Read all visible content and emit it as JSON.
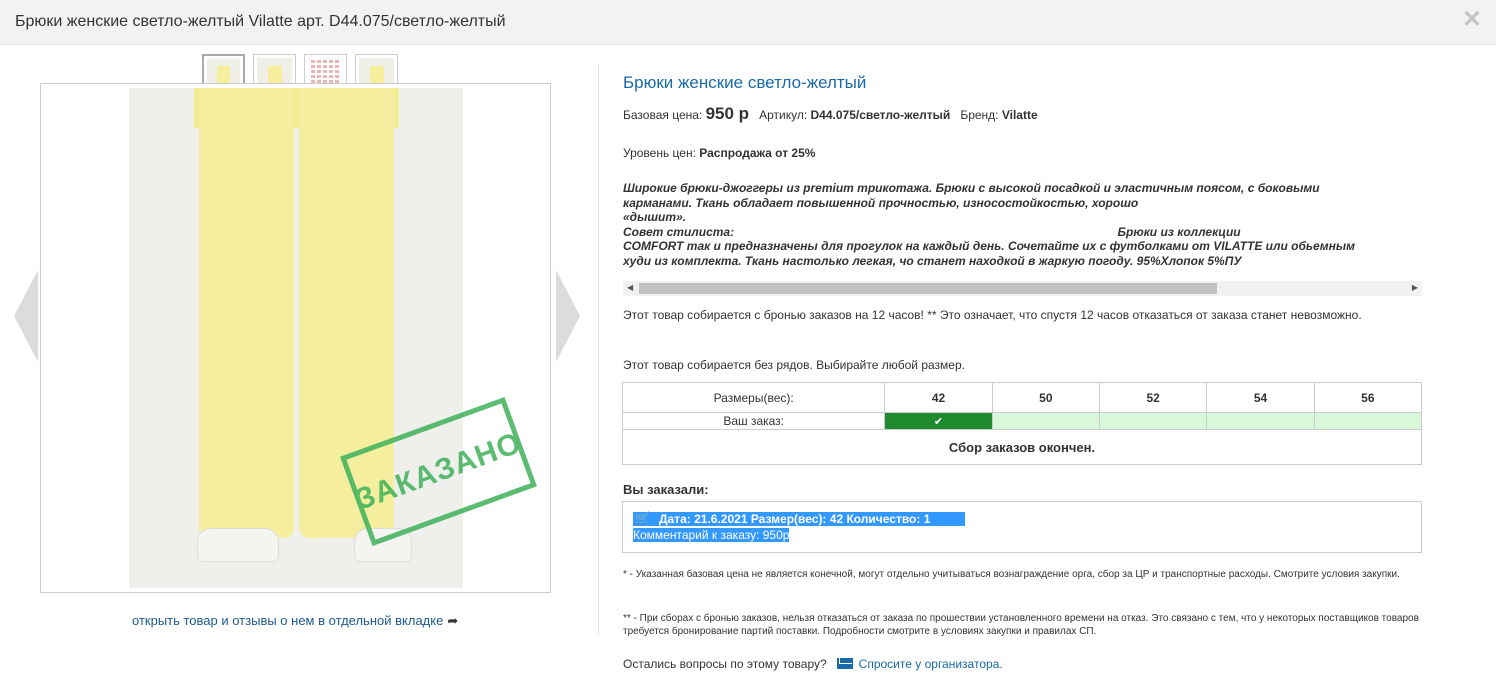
{
  "header": {
    "title": "Брюки женские светло-желтый Vilatte арт. D44.075/светло-желтый",
    "close": "✕"
  },
  "gallery": {
    "thumbnail_count": 4,
    "stamp_text": "ЗАКАЗАНО",
    "open_link": "открыть товар и отзывы о нем в отдельной вкладке",
    "share_icon": "➦"
  },
  "product": {
    "title": "Брюки женские светло-желтый",
    "base_price_label": "Базовая цена:",
    "base_price_value": "950 р",
    "article_label": "Артикул:",
    "article_value": "D44.075/светло-желтый",
    "brand_label": "Бренд:",
    "brand_value": "Vilatte",
    "price_level_label": "Уровень цен:",
    "price_level_value": "Распродажа от 25%",
    "description": "Широкие брюки-джоггеры из premium трикотажа. Брюки с высокой посадкой и эластичным поясом, с боковыми\nкарманами. Ткань обладает повышенной прочностью, износостойкостью, хорошо\n«дышит».\nСовет стилиста:                                                                                                                   Брюки из коллекции\nCOMFORT так и предназначены для прогулок на каждый день. Сочетайте их с футболками от VILATTE или обьемным\nхуди из комплекта. Ткань настолько легкая, чо станет находкой в жаркую погоду. 95%Хлопок 5%ПУ",
    "notice_reservation": "Этот товар собирается с бронью заказов на 12 часов! ** Это означает, что спустя 12 часов отказаться от заказа станет невозможно.",
    "notice_sizes": "Этот товар собирается без рядов. Выбирайте любой размер."
  },
  "sizes": {
    "header_label": "Размеры(вес):",
    "order_label": "Ваш заказ:",
    "values": [
      "42",
      "50",
      "52",
      "54",
      "56"
    ],
    "selected_index": 0,
    "check": "✔",
    "closed_text": "Сбор заказов окончен."
  },
  "order": {
    "label": "Вы заказали:",
    "line1": "Дата: 21.6.2021   Размер(вес): 42   Количество: 1",
    "line2": "Комментарий к заказу: 950р",
    "cart_icon": "🛒"
  },
  "footnotes": {
    "note1": "* - Указанная базовая цена не является конечной, могут отдельно учитываться вознаграждение орга, сбор за ЦР и транспортные расходы. Смотрите условия закупки.",
    "note2": "** - При сборах с бронью заказов, нельзя отказаться от заказа по прошествии установленного времени на отказ. Это связано с тем, что у некоторых поставщиков товаров требуется бронирование партий поставки. Подробности смотрите в условиях закупки и правилах СП."
  },
  "contact": {
    "question": "Остались вопросы по этому товару?",
    "ask_link": "Спросите у организатора."
  }
}
